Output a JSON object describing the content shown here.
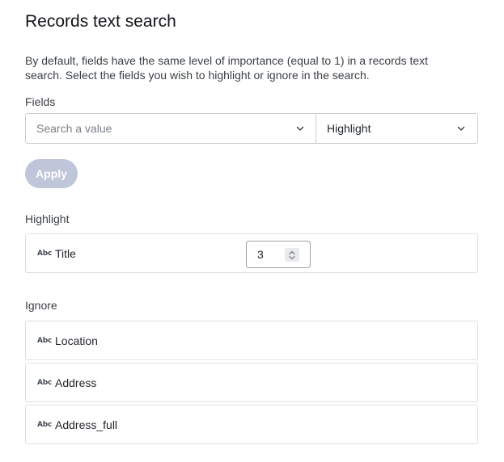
{
  "header": {
    "title": "Records text search",
    "description": "By default, fields have the same level of importance (equal to 1) in a records text search. Select the fields you wish to highlight or ignore in the search."
  },
  "fields_section": {
    "label": "Fields",
    "search_placeholder": "Search a value",
    "mode_value": "Highlight",
    "apply_label": "Apply"
  },
  "highlight_section": {
    "label": "Highlight",
    "items": [
      {
        "type_icon": "Abc",
        "label": "Title",
        "weight": "3"
      }
    ]
  },
  "ignore_section": {
    "label": "Ignore",
    "items": [
      {
        "type_icon": "Abc",
        "label": "Location"
      },
      {
        "type_icon": "Abc",
        "label": "Address"
      },
      {
        "type_icon": "Abc",
        "label": "Address_full"
      }
    ]
  },
  "colors": {
    "apply_disabled_bg": "#c0c6d9",
    "border": "#c9ccd2",
    "text": "#1f2328"
  },
  "icons": {
    "dropdown": "chevron-down-icon",
    "field_type": "text-type-icon",
    "stepper": "spin-arrows-icon"
  }
}
